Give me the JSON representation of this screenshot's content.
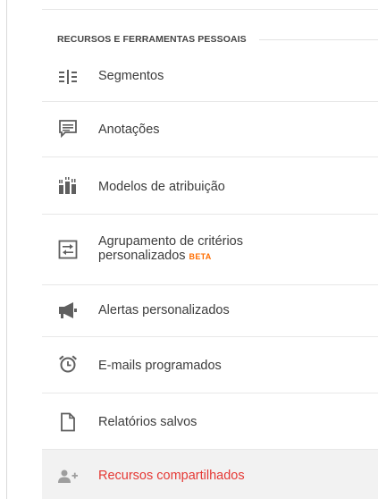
{
  "section": {
    "title": "RECURSOS E FERRAMENTAS PESSOAIS"
  },
  "menu": {
    "items": [
      {
        "label": "Segmentos",
        "icon": "segments-icon"
      },
      {
        "label": "Anotações",
        "icon": "annotation-icon"
      },
      {
        "label": "Modelos de atribuição",
        "icon": "attribution-chart-icon"
      },
      {
        "label_line1": "Agrupamento de critérios",
        "label_line2": "personalizados",
        "badge": "BETA",
        "icon": "channel-grouping-icon"
      },
      {
        "label": "Alertas personalizados",
        "icon": "megaphone-icon"
      },
      {
        "label": "E-mails programados",
        "icon": "alarm-clock-icon"
      },
      {
        "label": "Relatórios salvos",
        "icon": "document-icon"
      },
      {
        "label": "Recursos compartilhados",
        "icon": "add-user-icon"
      }
    ]
  },
  "colors": {
    "active_text": "#e53935",
    "beta": "#ff6d00",
    "icon": "#5f5f5f",
    "active_icon": "#9e9e9e"
  }
}
